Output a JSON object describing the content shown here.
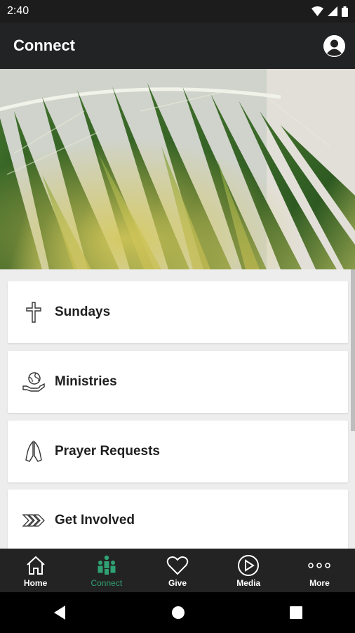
{
  "status_bar": {
    "time": "2:40"
  },
  "app_bar": {
    "title": "Connect"
  },
  "menu": [
    {
      "label": "Sundays",
      "icon": "cross-icon"
    },
    {
      "label": "Ministries",
      "icon": "hand-globe-icon"
    },
    {
      "label": "Prayer Requests",
      "icon": "praying-hands-icon"
    },
    {
      "label": "Get Involved",
      "icon": "chevrons-right-icon"
    }
  ],
  "bottom_nav": [
    {
      "label": "Home",
      "icon": "home-icon"
    },
    {
      "label": "Connect",
      "icon": "people-icon",
      "active": true
    },
    {
      "label": "Give",
      "icon": "heart-icon"
    },
    {
      "label": "Media",
      "icon": "play-circle-icon"
    },
    {
      "label": "More",
      "icon": "more-dots-icon"
    }
  ],
  "colors": {
    "accent": "#2fa173",
    "bar": "#222324",
    "background": "#ededed"
  }
}
